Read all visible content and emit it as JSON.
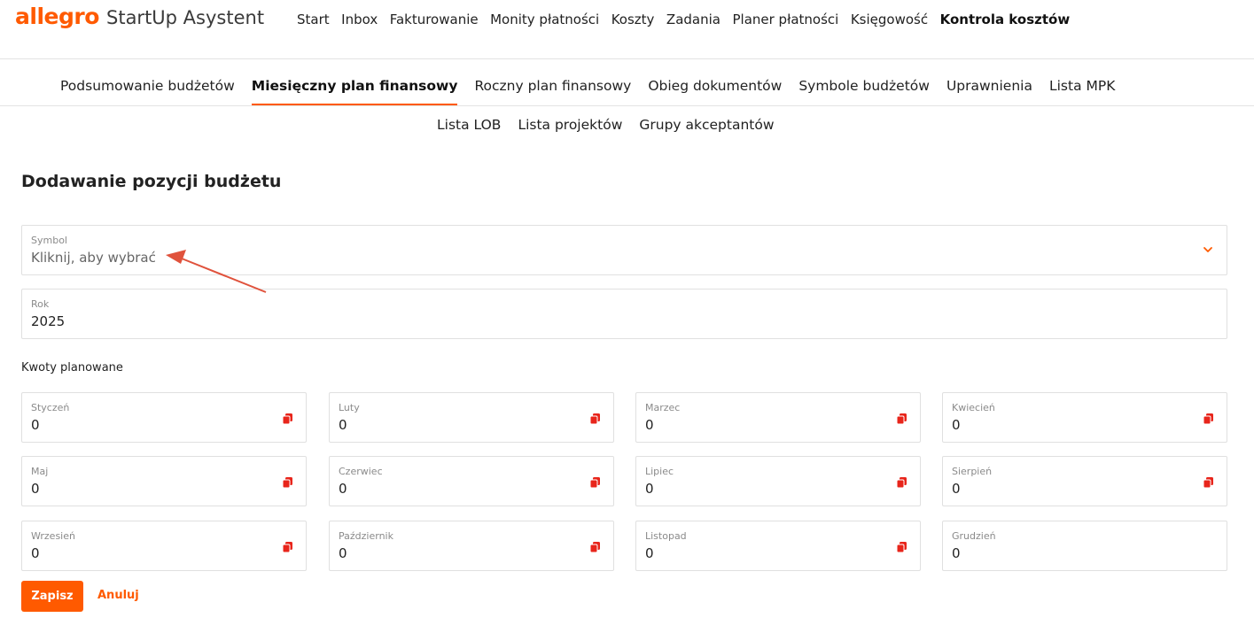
{
  "header": {
    "logo": "allegro",
    "app_title": "StartUp Asystent",
    "nav": [
      {
        "label": "Start"
      },
      {
        "label": "Inbox"
      },
      {
        "label": "Fakturowanie"
      },
      {
        "label": "Monity płatności"
      },
      {
        "label": "Koszty"
      },
      {
        "label": "Zadania"
      },
      {
        "label": "Planer płatności"
      },
      {
        "label": "Księgowość"
      },
      {
        "label": "Kontrola kosztów",
        "active": true
      }
    ]
  },
  "subnav": {
    "row1": [
      {
        "label": "Podsumowanie budżetów"
      },
      {
        "label": "Miesięczny plan finansowy",
        "active": true
      },
      {
        "label": "Roczny plan finansowy"
      },
      {
        "label": "Obieg dokumentów"
      },
      {
        "label": "Symbole budżetów"
      },
      {
        "label": "Uprawnienia"
      },
      {
        "label": "Lista MPK"
      }
    ],
    "row2": [
      {
        "label": "Lista LOB"
      },
      {
        "label": "Lista projektów"
      },
      {
        "label": "Grupy akceptantów"
      }
    ]
  },
  "page": {
    "title": "Dodawanie pozycji budżetu"
  },
  "form": {
    "symbol": {
      "label": "Symbol",
      "placeholder": "Kliknij, aby wybrać"
    },
    "rok": {
      "label": "Rok",
      "value": "2025"
    },
    "planned_label": "Kwoty planowane",
    "months": [
      {
        "label": "Styczeń",
        "value": "0"
      },
      {
        "label": "Luty",
        "value": "0"
      },
      {
        "label": "Marzec",
        "value": "0"
      },
      {
        "label": "Kwiecień",
        "value": "0"
      },
      {
        "label": "Maj",
        "value": "0"
      },
      {
        "label": "Czerwiec",
        "value": "0"
      },
      {
        "label": "Lipiec",
        "value": "0"
      },
      {
        "label": "Sierpień",
        "value": "0"
      },
      {
        "label": "Wrzesień",
        "value": "0"
      },
      {
        "label": "Październik",
        "value": "0"
      },
      {
        "label": "Listopad",
        "value": "0"
      },
      {
        "label": "Grudzień",
        "value": "0"
      }
    ],
    "save_label": "Zapisz",
    "cancel_label": "Anuluj"
  },
  "colors": {
    "accent": "#ff5a00",
    "copy_icon": "#e8251b",
    "annotation_arrow": "#e0523c"
  },
  "icons": {
    "dropdown": "chevron-down-icon",
    "copy": "copy-icon"
  }
}
